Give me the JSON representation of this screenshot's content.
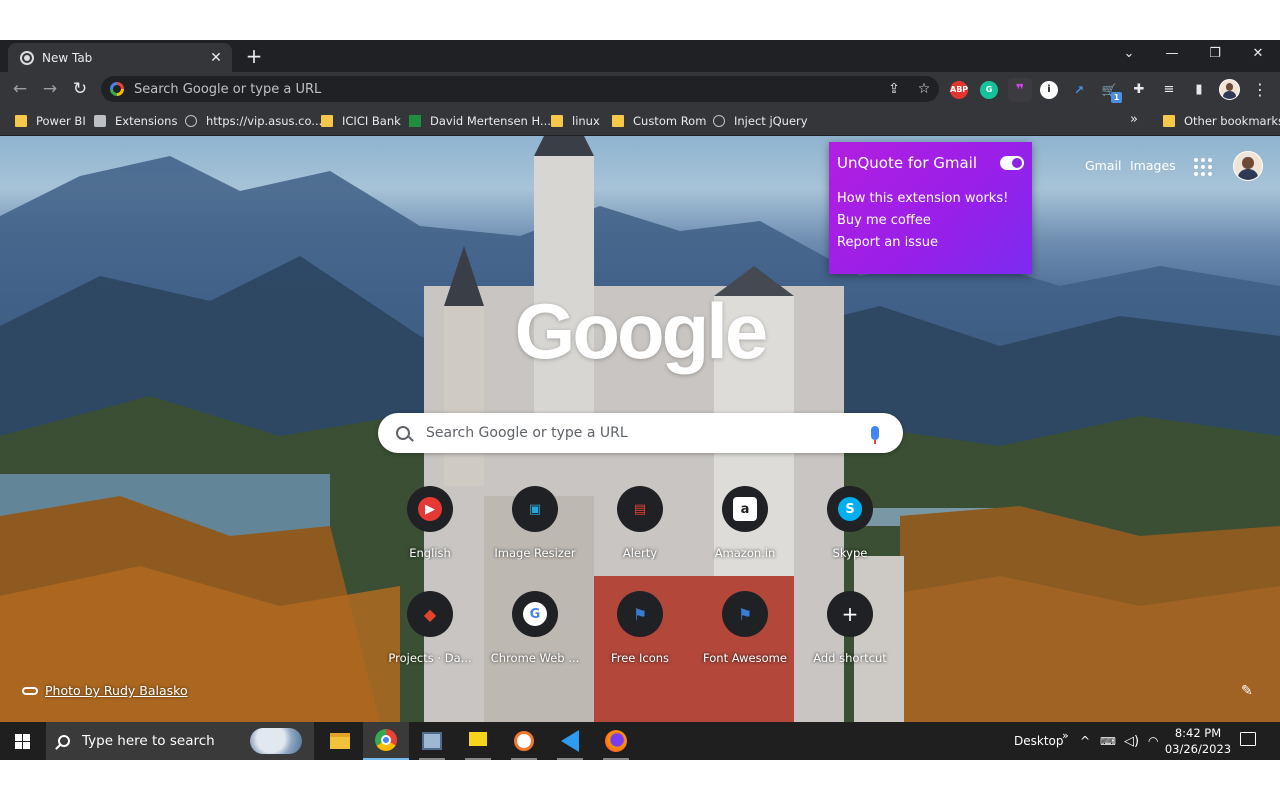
{
  "browser": {
    "tab": {
      "title": "New Tab",
      "close": "✕"
    },
    "new_tab": "+",
    "window_controls": {
      "tab_search": "⌄",
      "minimize": "—",
      "maximize": "❐",
      "close": "✕"
    },
    "nav": {
      "back": "←",
      "forward": "→",
      "reload": "↻"
    },
    "omnibox": {
      "placeholder": "Search Google or type a URL",
      "share_icon": "⇪",
      "star_icon": "☆"
    },
    "extensions": [
      {
        "name": "adblock-plus-icon",
        "label": "ABP",
        "color": "#e3342f"
      },
      {
        "name": "grammarly-icon",
        "label": "G",
        "color": "#15c39a"
      },
      {
        "name": "unquote-icon",
        "label": "❞",
        "color": "#c51fd6"
      },
      {
        "name": "info-extension-icon",
        "label": "i",
        "color": "#ffffff"
      },
      {
        "name": "chart-extension-icon",
        "label": "↗",
        "color": "#4a90e2"
      },
      {
        "name": "cart-extension-icon",
        "label": "🛒",
        "color": "#f6b400"
      }
    ],
    "extension_badge": "1",
    "toolbar_icons": {
      "extensions": "✚",
      "media": "≡",
      "side_panel": "▮",
      "menu": "⋮"
    }
  },
  "bookmarks": [
    {
      "label": "Power BI",
      "icon": "folder"
    },
    {
      "label": "Extensions",
      "icon": "puzzle"
    },
    {
      "label": "https://vip.asus.co...",
      "icon": "globe"
    },
    {
      "label": "ICICI Bank",
      "icon": "folder"
    },
    {
      "label": "David Mertensen H...",
      "icon": "greenplus"
    },
    {
      "label": "linux",
      "icon": "folder"
    },
    {
      "label": "Custom Rom",
      "icon": "folder"
    },
    {
      "label": "Inject jQuery",
      "icon": "globe"
    }
  ],
  "bookmarks_more": "»",
  "other_bookmarks": "Other bookmarks",
  "popup": {
    "title": "UnQuote for Gmail",
    "links": [
      "How this extension works!",
      "Buy me coffee",
      "Report an issue"
    ],
    "toggle_on": true
  },
  "ntp": {
    "links": {
      "gmail": "Gmail",
      "images": "Images"
    },
    "logo": "Google",
    "search_placeholder": "Search Google or type a URL",
    "shortcuts": [
      {
        "label": "English",
        "glyph": "▶",
        "color": "#e53935"
      },
      {
        "label": "Image Resizer",
        "glyph": "▣",
        "color": "#26a6d9"
      },
      {
        "label": "Alerty",
        "glyph": "▤",
        "color": "#e94235"
      },
      {
        "label": "Amazon.in",
        "glyph": "a",
        "color": "#ffffff"
      },
      {
        "label": "Skype",
        "glyph": "S",
        "color": "#00aff0"
      },
      {
        "label": "Projects · Da...",
        "glyph": "◆",
        "color": "#e24329"
      },
      {
        "label": "Chrome Web ...",
        "glyph": "G",
        "color": "#ffffff"
      },
      {
        "label": "Free Icons",
        "glyph": "⚑",
        "color": "#3a7bd5"
      },
      {
        "label": "Font Awesome",
        "glyph": "⚑",
        "color": "#3a7bd5"
      },
      {
        "label": "Add shortcut",
        "glyph": "+",
        "color": "#ffffff"
      }
    ],
    "photo_credit": "Photo by Rudy Balasko",
    "edit_icon": "✎"
  },
  "taskbar": {
    "search_placeholder": "Type here to search",
    "desktop_label": "Desktop",
    "tray_chevron": "^",
    "time": "8:42 PM",
    "date": "03/26/2023",
    "apps": [
      {
        "name": "file-explorer-icon"
      },
      {
        "name": "chrome-icon"
      },
      {
        "name": "network-tool-icon"
      },
      {
        "name": "sticky-notes-icon"
      },
      {
        "name": "clock-app-icon"
      },
      {
        "name": "vscode-icon"
      },
      {
        "name": "firefox-icon"
      }
    ]
  },
  "colors": {
    "chrome_dark": "#202124",
    "toolbar": "#35363a",
    "popup_accent": "#9a1fe8"
  }
}
